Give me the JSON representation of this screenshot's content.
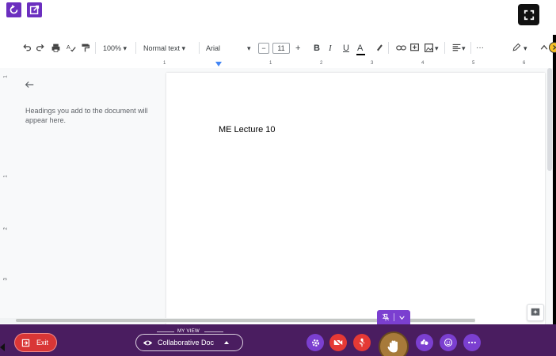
{
  "toolbar": {
    "zoom": "100%",
    "style": "Normal text",
    "font": "Arial",
    "font_size": "11",
    "more": "···"
  },
  "ruler": {
    "marks": [
      "1",
      "1",
      "2",
      "3",
      "4",
      "5",
      "6"
    ]
  },
  "vruler": {
    "marks": [
      "1",
      "1",
      "2",
      "3"
    ]
  },
  "outline": {
    "hint": "Headings you add to the document will appear here."
  },
  "document": {
    "text": "ME Lecture 10"
  },
  "bottom_bar": {
    "exit_label": "Exit",
    "view_group_label": "MY VIEW",
    "view_value": "Collaborative Doc"
  },
  "colors": {
    "purple_dark": "#4a1d60",
    "purple": "#7b3fd0",
    "red": "#d93636",
    "hand": "#a77a3a"
  },
  "icons": [
    "undo-icon",
    "redo-icon",
    "print-icon",
    "spellcheck-icon",
    "paint-format-icon",
    "link-icon",
    "comment-icon",
    "image-icon",
    "align-icon",
    "edit-pencil-icon",
    "chevron-up-icon",
    "back-arrow-icon",
    "explore-icon",
    "settings-icon",
    "video-off-icon",
    "mic-off-icon",
    "hand-icon",
    "shapes-icon",
    "emoji-icon",
    "more-icon",
    "pin-off-icon",
    "eye-icon",
    "exit-icon",
    "fullscreen-icon",
    "refresh-icon",
    "external-link-icon"
  ]
}
